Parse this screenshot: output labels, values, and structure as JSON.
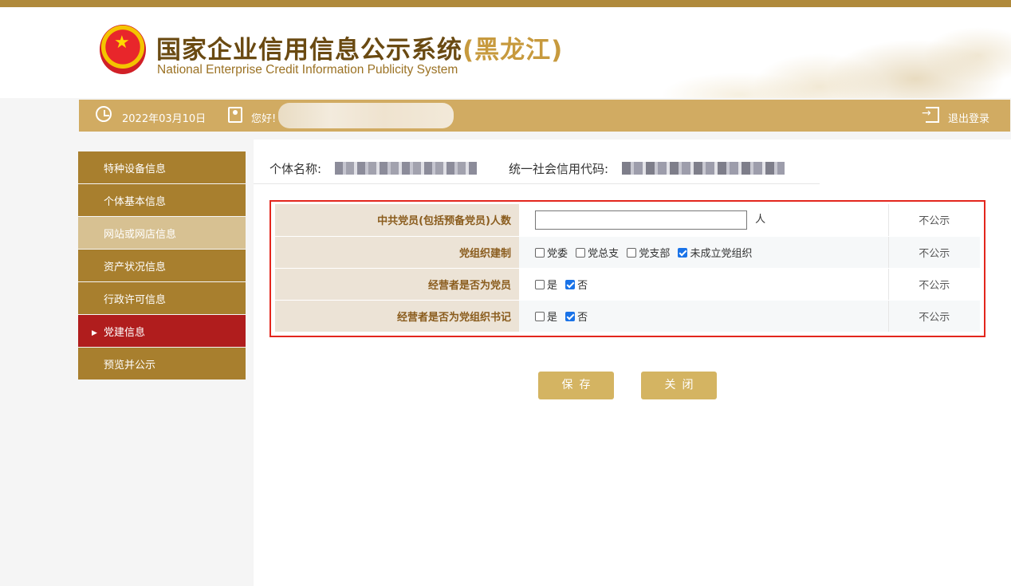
{
  "header": {
    "title_cn": "国家企业信用信息公示系统",
    "title_province": "(黑龙江)",
    "title_en": "National Enterprise Credit Information Publicity System"
  },
  "topbar": {
    "date": "2022年03月10日",
    "greeting": "您好!",
    "logout_label": "退出登录"
  },
  "sidebar": {
    "items": [
      {
        "label": "特种设备信息",
        "state": "normal"
      },
      {
        "label": "个体基本信息",
        "state": "normal"
      },
      {
        "label": "网站或网店信息",
        "state": "dim"
      },
      {
        "label": "资产状况信息",
        "state": "normal"
      },
      {
        "label": "行政许可信息",
        "state": "normal"
      },
      {
        "label": "党建信息",
        "state": "active"
      },
      {
        "label": "预览并公示",
        "state": "normal"
      }
    ]
  },
  "info": {
    "name_label": "个体名称:",
    "code_label": "统一社会信用代码:"
  },
  "form": {
    "rows": [
      {
        "label": "中共党员(包括预备党员)人数",
        "input_value": "",
        "unit": "人",
        "publicity": "不公示"
      },
      {
        "label": "党组织建制",
        "options": [
          "党委",
          "党总支",
          "党支部",
          "未成立党组织"
        ],
        "checked": [
          false,
          false,
          false,
          true
        ],
        "publicity": "不公示"
      },
      {
        "label": "经营者是否为党员",
        "options": [
          "是",
          "否"
        ],
        "checked": [
          false,
          true
        ],
        "publicity": "不公示"
      },
      {
        "label": "经营者是否为党组织书记",
        "options": [
          "是",
          "否"
        ],
        "checked": [
          false,
          true
        ],
        "publicity": "不公示"
      }
    ]
  },
  "buttons": {
    "save": "保存",
    "close": "关闭"
  },
  "colors": {
    "gold": "#d1ab62",
    "nav_bg": "#a87f2e",
    "nav_active": "#b01d1d",
    "highlight_border": "#e3261d"
  }
}
